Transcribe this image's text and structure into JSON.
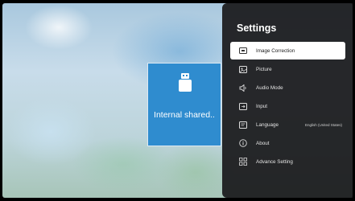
{
  "storage": {
    "tile_label": "Internal shared.."
  },
  "settings": {
    "title": "Settings",
    "items": [
      {
        "label": "Image Correction",
        "icon": "image-correction-icon",
        "selected": true
      },
      {
        "label": "Picture",
        "icon": "picture-icon"
      },
      {
        "label": "Audio Mode",
        "icon": "speaker-icon"
      },
      {
        "label": "Input",
        "icon": "input-icon"
      },
      {
        "label": "Language",
        "icon": "language-icon",
        "value": "English (United States)"
      },
      {
        "label": "About",
        "icon": "info-icon"
      },
      {
        "label": "Advance Setting",
        "icon": "grid-icon"
      }
    ]
  },
  "colors": {
    "accent": "#2f8ccf",
    "panel": "#1c1c1e",
    "selected": "#ffffff"
  }
}
